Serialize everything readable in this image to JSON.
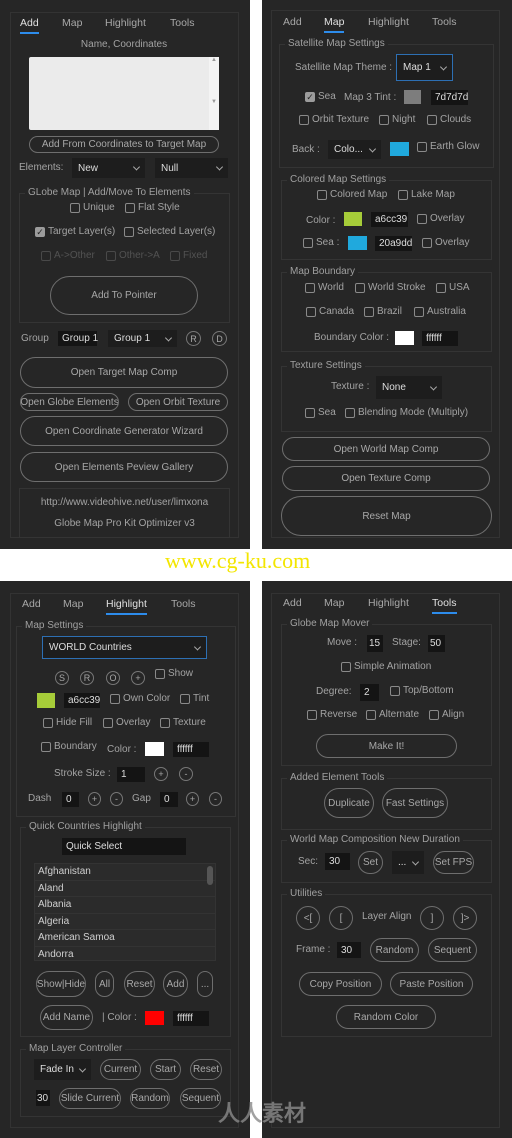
{
  "tabs": [
    "Add",
    "Map",
    "Highlight",
    "Tools"
  ],
  "colors": {
    "accent": "#2d8ceb",
    "panel": "#262626",
    "map3_tint": "#7d7d7d",
    "back_color": "#20a9dd",
    "map_color": "#a6cc39",
    "sea_color": "#20a9dd",
    "boundary_color": "#ffffff",
    "highlight_color": "#a6cc39",
    "highlight_boundary": "#ffffff",
    "name_color": "#ff0000"
  },
  "watermark": {
    "site": "www.cg-ku.com",
    "logo_text": "人人素材"
  },
  "add": {
    "name_label": "Name, Coordinates",
    "coordinates_value": "",
    "add_from_coords": "Add From Coordinates to Target Map",
    "elements_label": "Elements:",
    "elements_type": "New",
    "elements_kind": "Null",
    "group_title": "GLobe Map | Add/Move To Elements",
    "unique": "Unique",
    "flat_style": "Flat Style",
    "target_layers": "Target Layer(s)",
    "selected_layers": "Selected Layer(s)",
    "a_other": "A->Other",
    "other_a": "Other->A",
    "fixed": "Fixed",
    "add_to_pointer": "Add To Pointer",
    "group_label": "Group",
    "group_name": "Group 1",
    "group_select": "Group 1",
    "r": "R",
    "d": "D",
    "open_target": "Open Target Map Comp",
    "open_globe": "Open Globe Elements",
    "open_orbit": "Open Orbit Texture",
    "open_coord": "Open Coordinate Generator Wizard",
    "open_gallery": "Open Elements Peview Gallery",
    "url": "http://www.videohive.net/user/limxona",
    "product": "Globe Map Pro Kit Optimizer v3"
  },
  "map": {
    "sat_title": "Satellite Map Settings",
    "theme_label": "Satellite Map Theme :",
    "theme": "Map 1",
    "sea": "Sea",
    "tint_label": "Map 3 Tint :",
    "tint_hex": "7d7d7d",
    "orbit": "Orbit Texture",
    "night": "Night",
    "clouds": "Clouds",
    "back_label": "Back :",
    "back_select": "Colo...",
    "earth_glow": "Earth Glow",
    "colored_title": "Colored Map Settings",
    "colored_map": "Colored Map",
    "lake_map": "Lake Map",
    "color_label": "Color :",
    "color_hex": "a6cc39",
    "overlay": "Overlay",
    "sea_label": "Sea :",
    "sea_hex": "20a9dd",
    "boundary_title": "Map Boundary",
    "world": "World",
    "world_stroke": "World Stroke",
    "usa": "USA",
    "canada": "Canada",
    "brazil": "Brazil",
    "australia": "Australia",
    "boundary_color_label": "Boundary Color :",
    "boundary_hex": "ffffff",
    "texture_title": "Texture Settings",
    "texture_label": "Texture :",
    "texture": "None",
    "texture_sea": "Sea",
    "blending": "Blending Mode (Multiply)",
    "open_world": "Open World Map Comp",
    "open_texture": "Open Texture Comp",
    "reset": "Reset Map"
  },
  "highlight": {
    "settings_title": "Map Settings",
    "map_select": "WORLD Countries",
    "s": "S",
    "r": "R",
    "o": "O",
    "plus": "+",
    "minus": "-",
    "show": "Show",
    "color_hex": "a6cc39",
    "own_color": "Own Color",
    "tint": "Tint",
    "hide_fill": "Hide Fill",
    "overlay": "Overlay",
    "texture": "Texture",
    "boundary": "Boundary",
    "color_label": "Color :",
    "boundary_hex": "ffffff",
    "stroke_label": "Stroke Size :",
    "stroke": "1",
    "dash_label": "Dash",
    "dash": "0",
    "gap_label": "Gap",
    "gap": "0",
    "quick_title": "Quick Countries Highlight",
    "quick_select": "Quick Select",
    "countries": [
      "Afghanistan",
      "Aland",
      "Albania",
      "Algeria",
      "American Samoa",
      "Andorra"
    ],
    "show_hide": "Show|Hide",
    "all": "All",
    "reset": "Reset",
    "add": "Add",
    "more": "...",
    "add_name": "Add Name",
    "name_color_label": "| Color :",
    "name_hex": "ffffff",
    "layer_title": "Map Layer Controller",
    "fade": "Fade In",
    "current": "Current",
    "start": "Start",
    "reset2": "Reset",
    "frames": "30",
    "slide_current": "Slide Current",
    "random": "Random",
    "sequent": "Sequent"
  },
  "tools": {
    "mover_title": "Globe Map Mover",
    "move_label": "Move :",
    "move": "15",
    "stage_label": "Stage:",
    "stage": "50",
    "simple_anim": "Simple Animation",
    "degree_label": "Degree:",
    "degree": "2",
    "top_bottom": "Top/Bottom",
    "reverse": "Reverse",
    "alternate": "Alternate",
    "align": "Align",
    "make_it": "Make It!",
    "added_title": "Added Element Tools",
    "duplicate": "Duplicate",
    "fast_settings": "Fast Settings",
    "duration_title": "World Map Composition New Duration",
    "sec_label": "Sec:",
    "sec": "30",
    "set": "Set",
    "fps_select": "...",
    "set_fps": "Set FPS",
    "util_title": "Utilities",
    "align_first": "<[",
    "align_left": "[",
    "layer_align": "Layer Align",
    "align_right": "]",
    "align_last": "]>",
    "frame_label": "Frame :",
    "frame": "30",
    "random": "Random",
    "sequent": "Sequent",
    "copy_pos": "Copy Position",
    "paste_pos": "Paste Position",
    "random_color": "Random Color"
  }
}
